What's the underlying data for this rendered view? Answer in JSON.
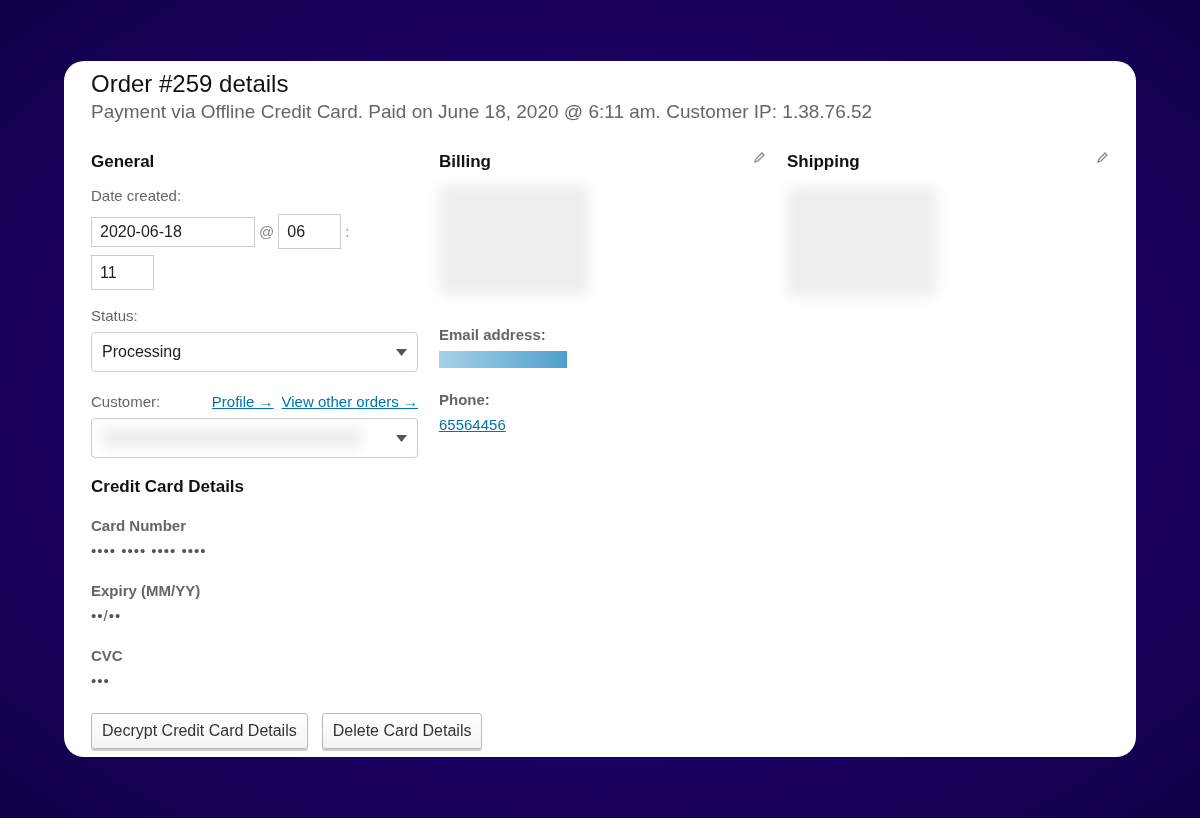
{
  "header": {
    "title": "Order #259 details",
    "subtitle": "Payment via Offline Credit Card. Paid on June 18, 2020 @ 6:11 am. Customer IP: 1.38.76.52"
  },
  "general": {
    "heading": "General",
    "date_label": "Date created:",
    "date": "2020-06-18",
    "at": "@",
    "hour": "06",
    "colon": ":",
    "minute": "11",
    "status_label": "Status:",
    "status": "Processing",
    "customer_label": "Customer:",
    "links": [
      "Profile →",
      "View other orders →"
    ]
  },
  "billing": {
    "heading": "Billing",
    "fields": [
      {
        "label": "Email address:",
        "kind": "redacted"
      },
      {
        "label": "Phone:",
        "kind": "link",
        "value": "65564456"
      }
    ]
  },
  "shipping": {
    "heading": "Shipping"
  },
  "card": {
    "heading": "Credit Card Details",
    "fields": [
      {
        "label": "Card Number",
        "value": "•••• •••• •••• ••••"
      },
      {
        "label": "Expiry (MM/YY)",
        "value": "••/••"
      },
      {
        "label": "CVC",
        "value": "•••"
      }
    ],
    "buttons": [
      "Decrypt Credit Card Details",
      "Delete Card Details"
    ]
  }
}
